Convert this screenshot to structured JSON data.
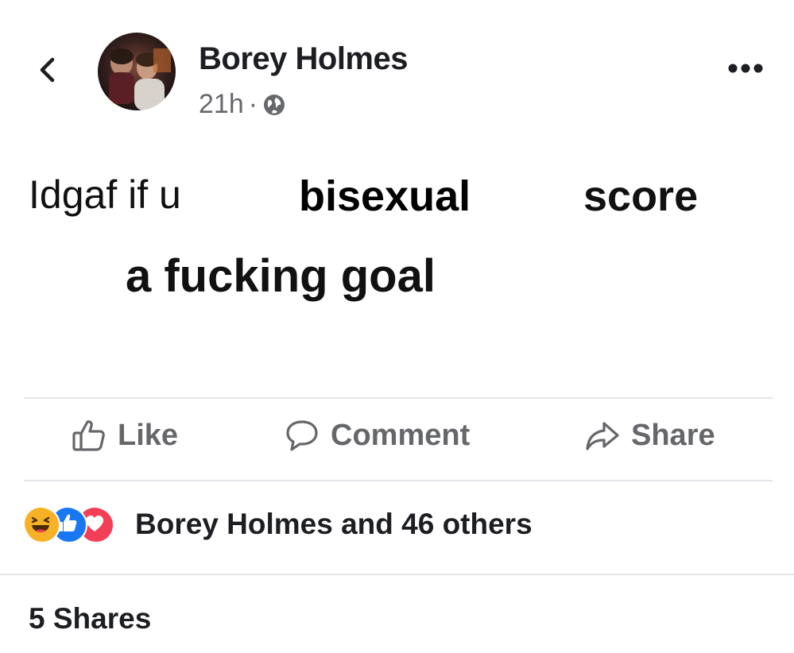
{
  "post": {
    "author_name": "Borey Holmes",
    "timestamp": "21h",
    "separator": "·",
    "privacy_icon": "globe-icon",
    "text_line1_a": "Idgaf if u",
    "text_line1_b": "bisexual",
    "text_line1_c": "score",
    "text_line2": "a fucking goal"
  },
  "actions": {
    "like_label": "Like",
    "comment_label": "Comment",
    "share_label": "Share"
  },
  "reactions": {
    "icons": [
      "haha-icon",
      "like-icon",
      "love-icon"
    ],
    "summary": "Borey Holmes and 46 others"
  },
  "shares": {
    "label": "5 Shares"
  },
  "colors": {
    "text": "#1c1e21",
    "muted": "#65676b",
    "divider": "#e4e6eb",
    "like_blue": "#1877f2",
    "love_red": "#f33e58",
    "haha_yellow": "#f7b125"
  }
}
